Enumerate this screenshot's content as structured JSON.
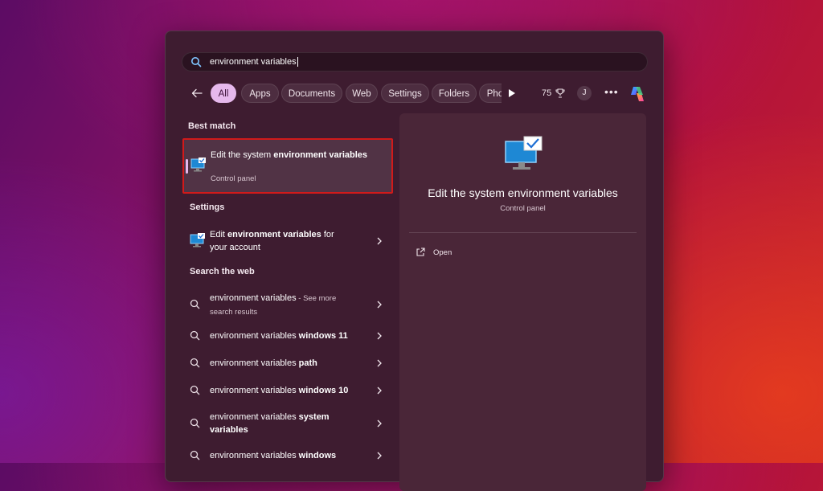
{
  "search": {
    "query": "environment variables"
  },
  "filters": {
    "chips": [
      "All",
      "Apps",
      "Documents",
      "Web",
      "Settings",
      "Folders",
      "Pho"
    ],
    "points": "75",
    "avatar_initial": "J",
    "more": "•••"
  },
  "sections": {
    "best_match": "Best match",
    "settings": "Settings",
    "search_web": "Search the web"
  },
  "best_match": {
    "title_pre": "Edit the system ",
    "title_bold": "environment variables",
    "subtitle": "Control panel"
  },
  "settings_item": {
    "pre": "Edit ",
    "bold": "environment variables",
    "post": " for your account"
  },
  "web_results": [
    {
      "pre": "environment variables",
      "bold": "",
      "suffix": " - See more search results"
    },
    {
      "pre": "environment variables ",
      "bold": "windows 11",
      "suffix": ""
    },
    {
      "pre": "environment variables ",
      "bold": "path",
      "suffix": ""
    },
    {
      "pre": "environment variables ",
      "bold": "windows 10",
      "suffix": ""
    },
    {
      "pre": "environment variables ",
      "bold": "system variables",
      "suffix": ""
    },
    {
      "pre": "environment variables ",
      "bold": "windows",
      "suffix": ""
    }
  ],
  "detail": {
    "title": "Edit the system environment variables",
    "subtitle": "Control panel",
    "open_label": "Open"
  },
  "colors": {
    "accent": "#e6b8ec",
    "highlight_border": "#d11a1a",
    "panel": "#3e1c30"
  }
}
